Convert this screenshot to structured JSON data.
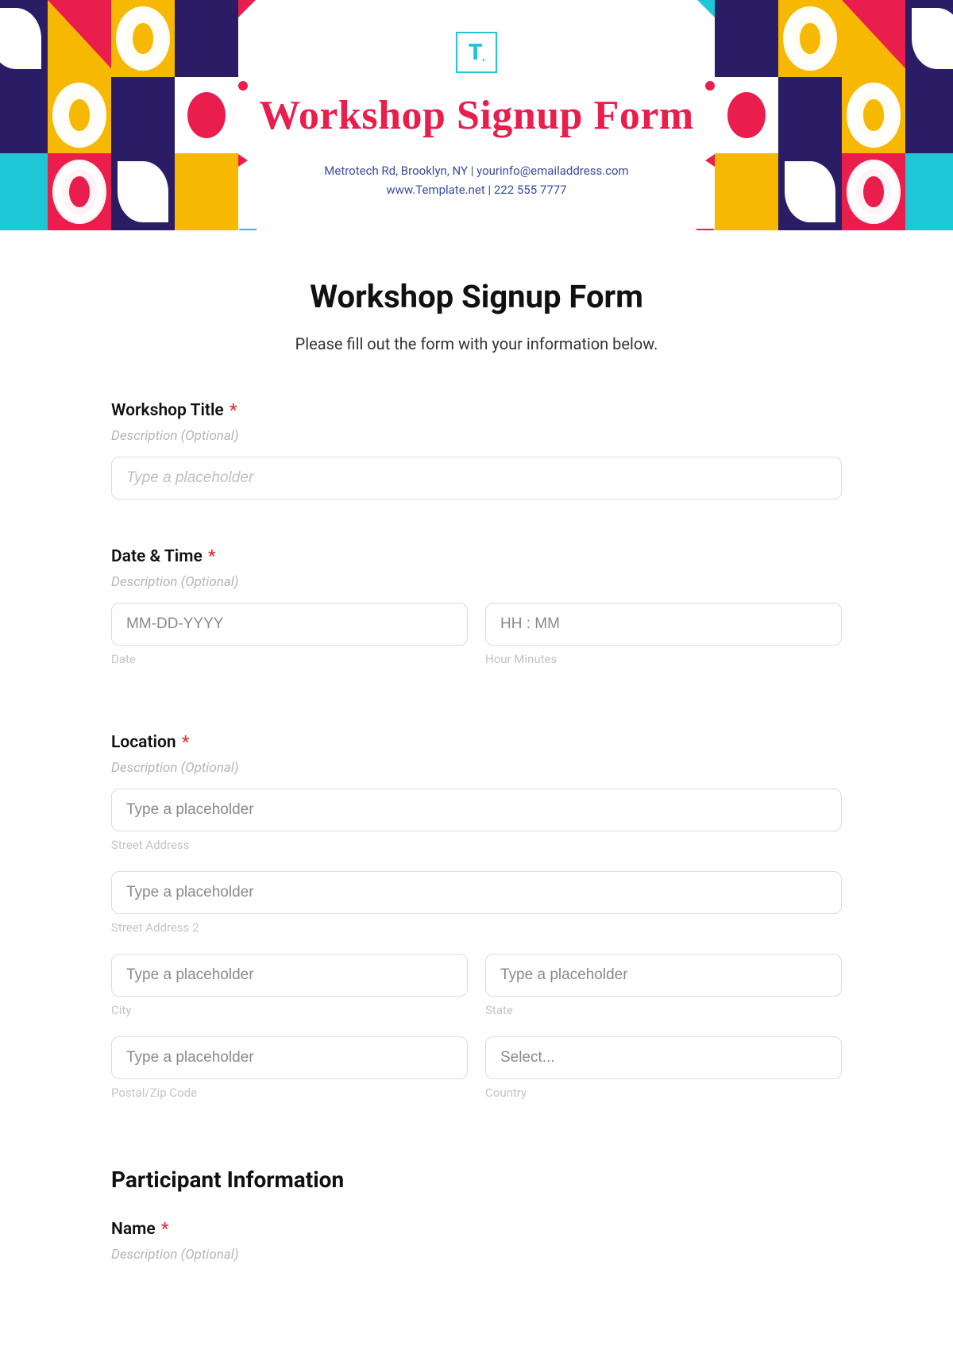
{
  "brand": {
    "logo_text": "T",
    "logo_dot": "."
  },
  "hero": {
    "title": "Workshop Signup Form",
    "sub_line1": "Metrotech Rd, Brooklyn, NY  |  yourinfo@emailaddress.com",
    "sub_line2": "www.Template.net  |  222 555 7777"
  },
  "form": {
    "title": "Workshop Signup Form",
    "subtitle": "Please fill out the form with your information below.",
    "required_mark": "*",
    "desc_optional": "Description (Optional)",
    "placeholder_generic": "Type a placeholder",
    "workshop_title": {
      "label": "Workshop Title"
    },
    "datetime": {
      "label": "Date & Time",
      "date_placeholder": "MM-DD-YYYY",
      "date_sublabel": "Date",
      "time_placeholder": "HH : MM",
      "time_sublabel": "Hour Minutes"
    },
    "location": {
      "label": "Location",
      "street": "Street Address",
      "street2": "Street Address 2",
      "city": "City",
      "state": "State",
      "postal": "Postal/Zip Code",
      "country": "Country",
      "country_placeholder": "Select..."
    },
    "participant": {
      "heading": "Participant Information",
      "name_label": "Name"
    }
  }
}
